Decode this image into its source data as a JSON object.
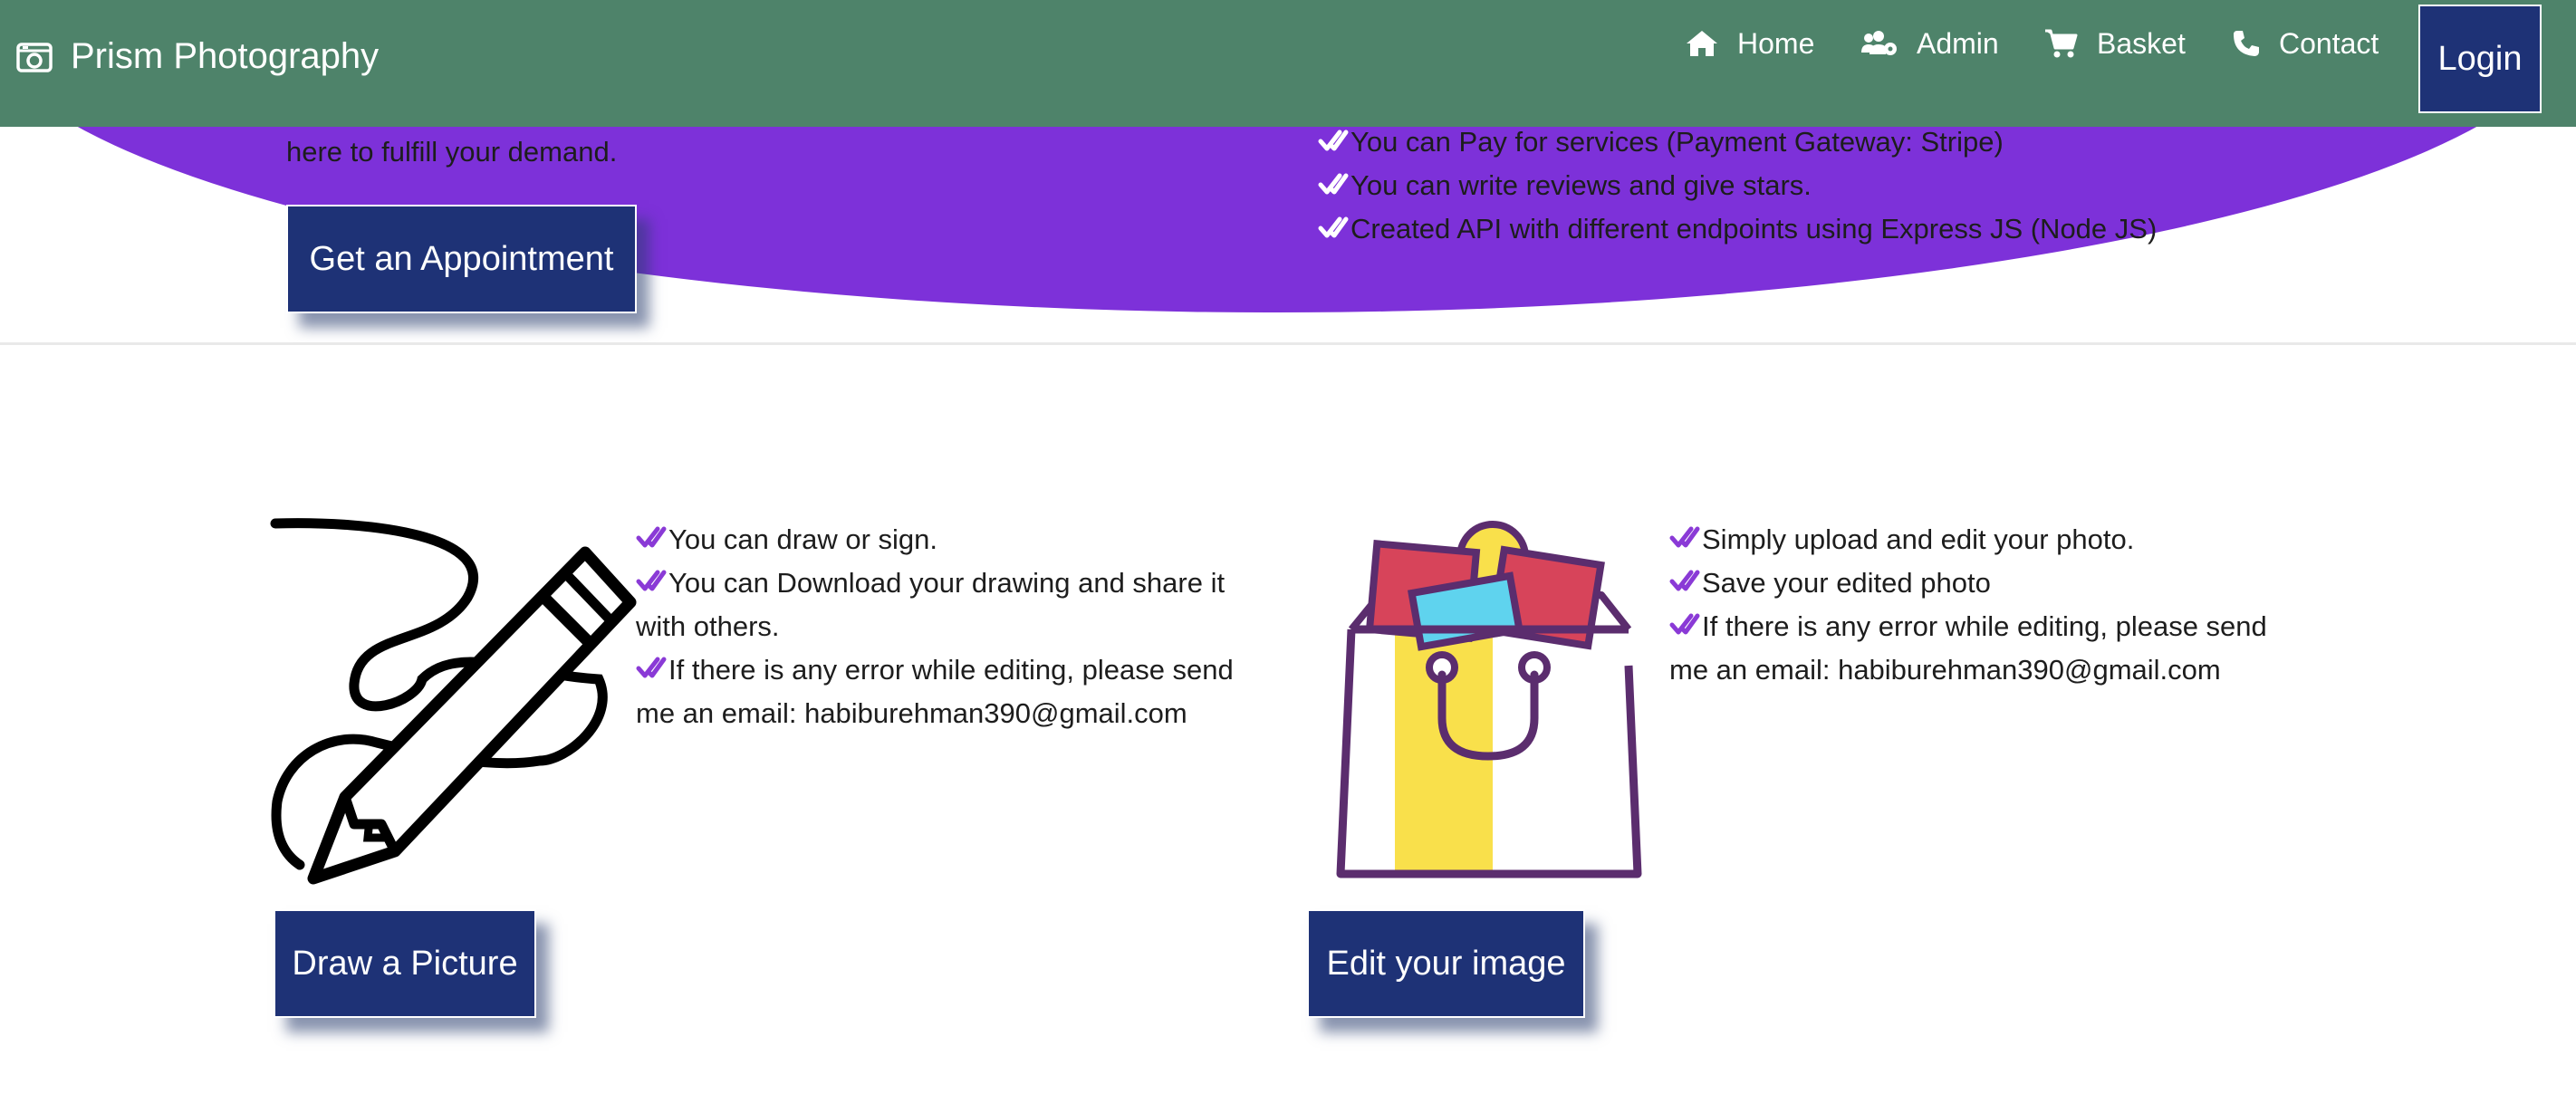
{
  "navbar": {
    "brand": "Prism Photography",
    "items": [
      {
        "label": "Home",
        "icon": "home-icon"
      },
      {
        "label": "Admin",
        "icon": "users-cog-icon"
      },
      {
        "label": "Basket",
        "icon": "cart-icon"
      },
      {
        "label": "Contact",
        "icon": "phone-icon"
      }
    ],
    "login_label": "Login"
  },
  "hero": {
    "text_fragment": "here to fulfill your demand.",
    "appointment_button": "Get an Appointment",
    "features": [
      "You can Pay for services (Payment Gateway: Stripe)",
      "You can write reviews and give stars.",
      "Created API with different endpoints using Express JS (Node JS)"
    ]
  },
  "draw_section": {
    "features": [
      "You can draw or sign.",
      "You can Download your drawing and share it with others.",
      "If there is any error while editing, please send me an email: habiburehman390@gmail.com"
    ],
    "button": "Draw a Picture",
    "illustration_icon": "pencil-drawing-icon"
  },
  "edit_section": {
    "features": [
      "Simply upload and edit your photo.",
      "Save your edited photo",
      "If there is any error while editing, please send me an email: habiburehman390@gmail.com"
    ],
    "button": "Edit your image",
    "illustration_icon": "photo-bag-icon"
  },
  "colors": {
    "navbar": "#4e836a",
    "hero_purple": "#7d31d9",
    "button_navy": "#1e3276",
    "check_purple": "#8a3ad6"
  }
}
